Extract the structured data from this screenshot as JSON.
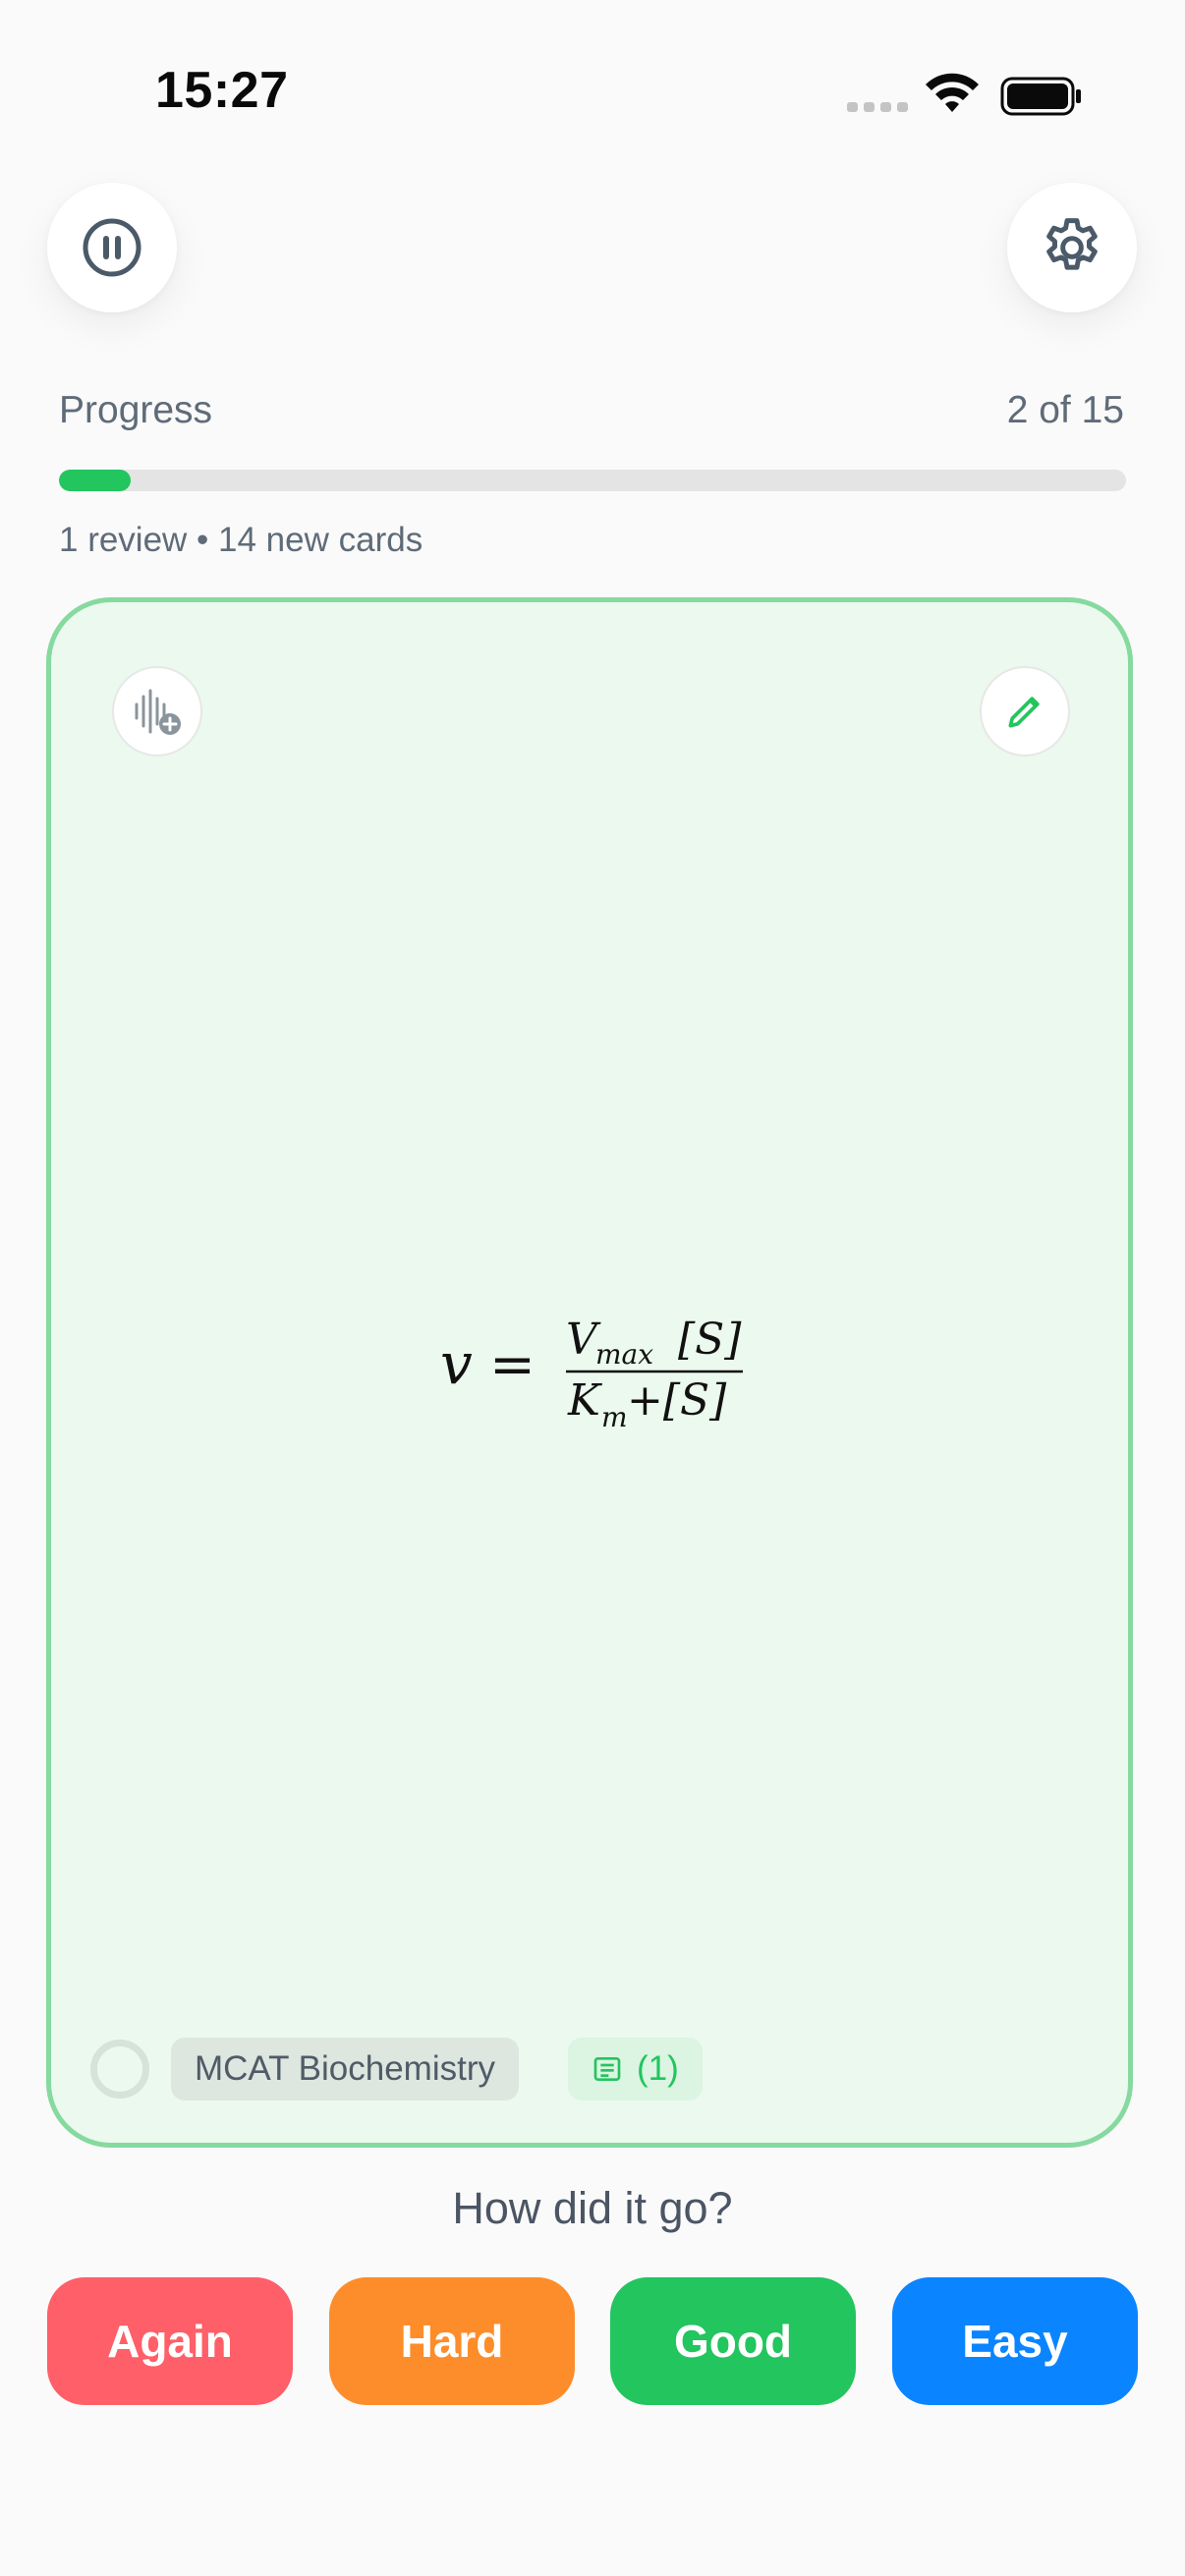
{
  "status_bar": {
    "time": "15:27"
  },
  "top_bar": {
    "pause_icon": "pause-icon",
    "settings_icon": "gear-icon"
  },
  "progress": {
    "label": "Progress",
    "count_text": "2 of 15",
    "fraction": 0.067,
    "subtext": "1 review • 14 new cards"
  },
  "card": {
    "audio_icon": "audio-add-icon",
    "edit_icon": "pencil-icon",
    "formula": {
      "lhs": "v",
      "equals": "=",
      "numerator_symbol": "V",
      "numerator_subscript": "max",
      "numerator_bracket": "[S]",
      "denominator_symbol": "K",
      "denominator_subscript": "m",
      "denominator_rest": "+[S]"
    },
    "deck_label": "MCAT Biochemistry",
    "notes_label": "(1)",
    "notes_icon": "note-icon"
  },
  "rating": {
    "prompt": "How did it go?",
    "again": "Again",
    "hard": "Hard",
    "good": "Good",
    "easy": "Easy"
  },
  "colors": {
    "accent_green": "#22c55e",
    "again_red": "#fe5f68",
    "hard_orange": "#fd8d2a",
    "easy_blue": "#0a84ff",
    "card_bg": "#ebf9ee",
    "card_border": "#86d99f"
  }
}
